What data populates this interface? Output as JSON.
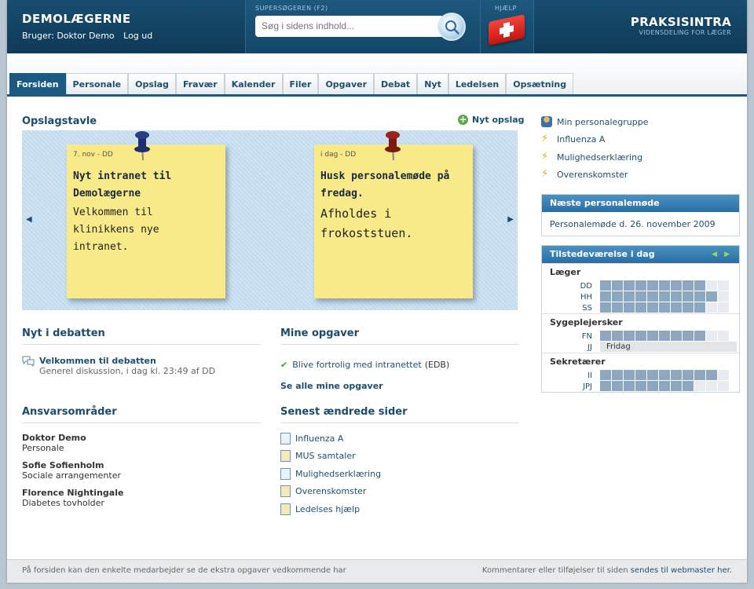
{
  "header": {
    "brand": "DEMOLÆGERNE",
    "user_label": "Bruger: Doktor Demo",
    "logout": "Log ud",
    "search_label": "SUPERSØGEREN (F2)",
    "search_placeholder": "Søg i sidens indhold...",
    "help_label": "HJÆLP",
    "logo_title": "PRAKSISINTRA",
    "logo_sub": "VIDENSDELING FOR LÆGER"
  },
  "tabs": [
    "Forsiden",
    "Personale",
    "Opslag",
    "Fravær",
    "Kalender",
    "Filer",
    "Opgaver",
    "Debat",
    "Nyt",
    "Ledelsen",
    "Opsætning"
  ],
  "board": {
    "title": "Opslagstavle",
    "new_post": "Nyt opslag",
    "notes": [
      {
        "date": "7. nov - DD",
        "title": "Nyt intranet til Demolægerne",
        "body": "Velkommen til klinikkens nye intranet.",
        "pin_color": "#1f2f6b"
      },
      {
        "date": "i dag - DD",
        "title": "Husk personalemøde på fredag.",
        "body": "Afholdes i frokoststuen.",
        "pin_color": "#7a1a12"
      }
    ]
  },
  "debate": {
    "title": "Nyt i debatten",
    "item_title": "Velkommen til debatten",
    "item_meta": "Generel diskussion, i dag kl. 23:49 af DD"
  },
  "tasks": {
    "title": "Mine opgaver",
    "item": "Blive fortrolig med intranettet",
    "item_tag": "(EDB)",
    "see_all": "Se alle mine opgaver"
  },
  "responsibilities": {
    "title": "Ansvarsområder",
    "people": [
      {
        "name": "Doktor Demo",
        "role": "Personale"
      },
      {
        "name": "Sofie Sofienholm",
        "role": "Sociale arrangementer"
      },
      {
        "name": "Florence Nightingale",
        "role": "Diabetes tovholder"
      }
    ]
  },
  "recent": {
    "title": "Senest ændrede sider",
    "pages": [
      "Influenza A",
      "MUS samtaler",
      "Mulighedserklæring",
      "Overenskomster",
      "Ledelses hjælp"
    ]
  },
  "sidebar": {
    "links": [
      "Min personalegruppe",
      "Influenza A",
      "Mulighedserklæring",
      "Overenskomster"
    ],
    "meeting_title": "Næste personalemøde",
    "meeting_link": "Personalemøde d. 26. november 2009",
    "presence_title": "Tilstedeværelse i dag",
    "groups": [
      {
        "name": "Læger",
        "rows": [
          {
            "init": "DD",
            "on": 9,
            "note": ""
          },
          {
            "init": "HH",
            "on": 10,
            "note": ""
          },
          {
            "init": "SS",
            "on": 9,
            "note": ""
          }
        ]
      },
      {
        "name": "Sygeplejersker",
        "rows": [
          {
            "init": "FN",
            "on": 9,
            "note": ""
          },
          {
            "init": "JJ",
            "on": 0,
            "note": "Fridag"
          }
        ]
      },
      {
        "name": "Sekretærer",
        "rows": [
          {
            "init": "II",
            "on": 10,
            "note": ""
          },
          {
            "init": "JPJ",
            "on": 8,
            "note": ""
          }
        ]
      }
    ]
  },
  "footer": {
    "left": "På forsiden kan den enkelte medarbejder se de ekstra opgaver vedkommende har",
    "right_text": "Kommentarer eller tilføjelser til siden",
    "right_link": "sendes til webmaster her."
  }
}
